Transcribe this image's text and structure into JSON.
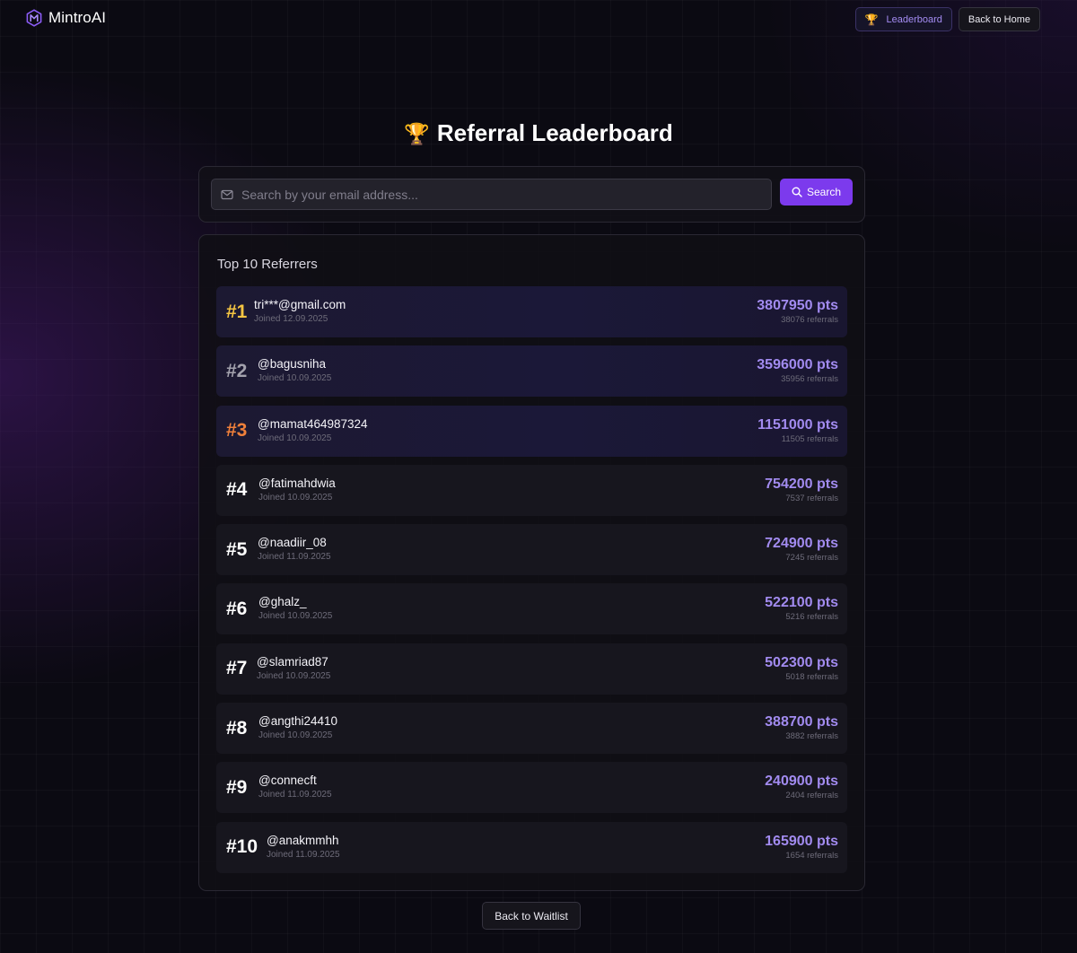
{
  "header": {
    "brand": "MintroAI",
    "leaderboard_label": "Leaderboard",
    "home_label": "Back to Home"
  },
  "title": "Referral Leaderboard",
  "search": {
    "placeholder": "Search by your email address...",
    "value": "",
    "button_label": "Search"
  },
  "board": {
    "heading": "Top 10 Referrers",
    "entries": [
      {
        "rank": "#1",
        "name": "tri***@gmail.com",
        "joined": "Joined 12.09.2025",
        "points": "3807950 pts",
        "referrals": "38076 referrals"
      },
      {
        "rank": "#2",
        "name": "@bagusniha",
        "joined": "Joined 10.09.2025",
        "points": "3596000 pts",
        "referrals": "35956 referrals"
      },
      {
        "rank": "#3",
        "name": "@mamat464987324",
        "joined": "Joined 10.09.2025",
        "points": "1151000 pts",
        "referrals": "11505 referrals"
      },
      {
        "rank": "#4",
        "name": "@fatimahdwia",
        "joined": "Joined 10.09.2025",
        "points": "754200 pts",
        "referrals": "7537 referrals"
      },
      {
        "rank": "#5",
        "name": "@naadiir_08",
        "joined": "Joined 11.09.2025",
        "points": "724900 pts",
        "referrals": "7245 referrals"
      },
      {
        "rank": "#6",
        "name": "@ghalz_",
        "joined": "Joined 10.09.2025",
        "points": "522100 pts",
        "referrals": "5216 referrals"
      },
      {
        "rank": "#7",
        "name": "@slamriad87",
        "joined": "Joined 10.09.2025",
        "points": "502300 pts",
        "referrals": "5018 referrals"
      },
      {
        "rank": "#8",
        "name": "@angthi24410",
        "joined": "Joined 10.09.2025",
        "points": "388700 pts",
        "referrals": "3882 referrals"
      },
      {
        "rank": "#9",
        "name": "@connecft",
        "joined": "Joined 11.09.2025",
        "points": "240900 pts",
        "referrals": "2404 referrals"
      },
      {
        "rank": "#10",
        "name": "@anakmmhh",
        "joined": "Joined 11.09.2025",
        "points": "165900 pts",
        "referrals": "1654 referrals"
      }
    ]
  },
  "footer": {
    "waitlist_label": "Back to Waitlist"
  },
  "icons": {
    "brand": "m-logo-icon",
    "leaderboard": "trophy-icon",
    "title": "trophy-icon",
    "search_field": "mail-icon",
    "search_button": "search-icon"
  },
  "colors": {
    "accent": "#7c3aed",
    "points": "#a28bf0",
    "gold": "#f5c542",
    "silver": "#a3a2ad",
    "bronze": "#f0803a"
  }
}
